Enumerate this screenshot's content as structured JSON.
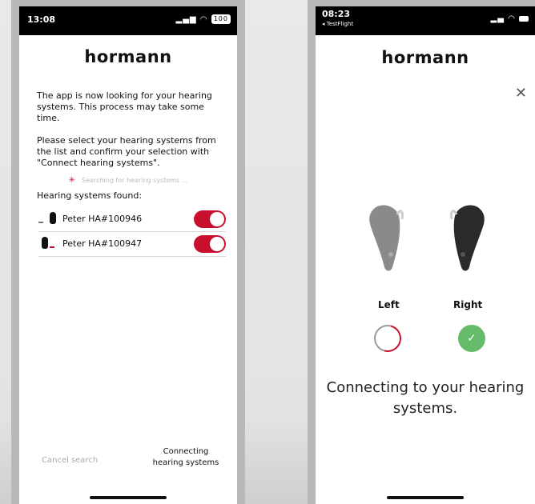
{
  "left_phone": {
    "status_time": "13:08",
    "battery": "100",
    "logo": "hormann",
    "intro_text": "The app is now looking for your hearing systems. This process may take some time.",
    "instruction_text": "Please select your hearing systems from the list and confirm your selection with \"Connect hearing systems\".",
    "searching_text": "Searching for hearing systems ...",
    "found_label": "Hearing systems found:",
    "devices": [
      {
        "name": "Peter HA#100946",
        "selected": true
      },
      {
        "name": "Peter HA#100947",
        "selected": true
      }
    ],
    "cancel_label": "Cancel search",
    "connect_label": "Connecting hearing systems",
    "accent_color": "#c8102e"
  },
  "right_phone": {
    "status_time": "08:23",
    "back_label": "◂ TestFlight",
    "logo": "hormann",
    "left_label": "Left",
    "right_label": "Right",
    "left_status": "connecting",
    "right_status": "connected",
    "message": "Connecting to your hearing systems.",
    "success_color": "#66bb6a"
  }
}
